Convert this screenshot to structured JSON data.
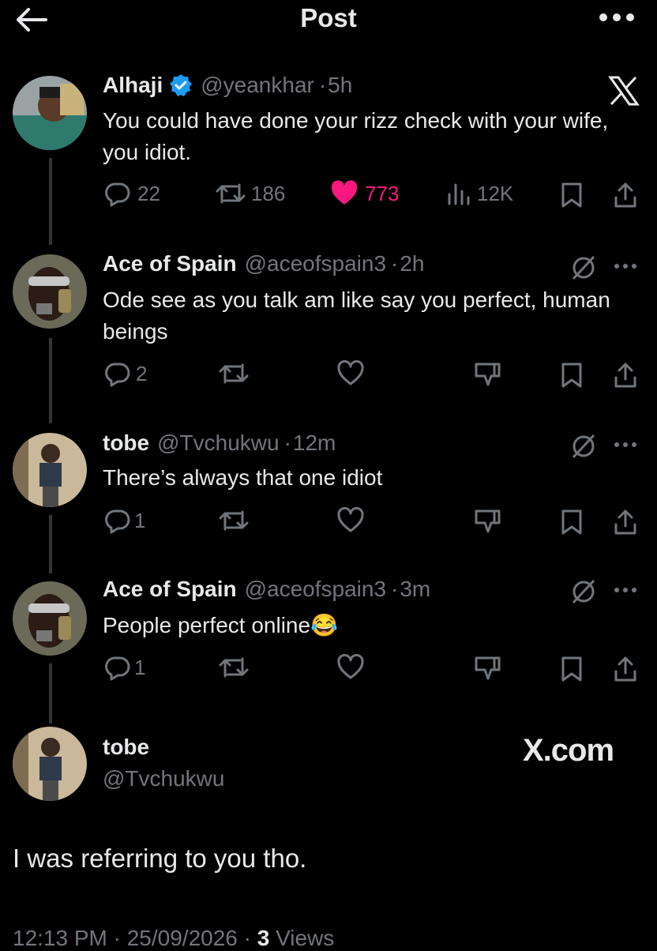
{
  "header": {
    "title": "Post"
  },
  "posts": [
    {
      "name": "Alhaji",
      "handle": "@yeankhar",
      "time": "5h",
      "text": "You could have done your rizz check with your wife, you idiot.",
      "replies": "22",
      "reposts": "186",
      "likes": "773",
      "views": "12K"
    },
    {
      "name": "Ace of Spain",
      "handle": "@aceofspain3",
      "time": "2h",
      "text": "Ode see as you talk am like say you perfect, human beings",
      "replies": "2"
    },
    {
      "name": "tobe",
      "handle": "@Tvchukwu",
      "time": "12m",
      "text": "There’s always that one idiot",
      "replies": "1"
    },
    {
      "name": "Ace of Spain",
      "handle": "@aceofspain3",
      "time": "3m",
      "text": "People perfect online😂",
      "replies": "1"
    }
  ],
  "main": {
    "name": "tobe",
    "handle": "@Tvchukwu",
    "watermark": "X.com",
    "text": "I was referring to you tho.",
    "timestamp": "12:13 PM · 25/09/2026 · ",
    "views_count": "3",
    "views_label": " Views"
  },
  "icons": {
    "back": "back-arrow-icon",
    "more": "more-icon",
    "verified": "verified-badge-icon",
    "x_logo": "x-logo-icon",
    "grok": "grok-icon",
    "reply": "reply-icon",
    "repost": "repost-icon",
    "like": "heart-icon",
    "dislike": "dislike-icon",
    "views": "views-icon",
    "bookmark": "bookmark-icon",
    "share": "share-icon"
  },
  "colors": {
    "background": "#000000",
    "text": "#e7e9ea",
    "muted": "#71767b",
    "like": "#f91880",
    "verified": "#1d9bf0",
    "line": "#333639"
  }
}
